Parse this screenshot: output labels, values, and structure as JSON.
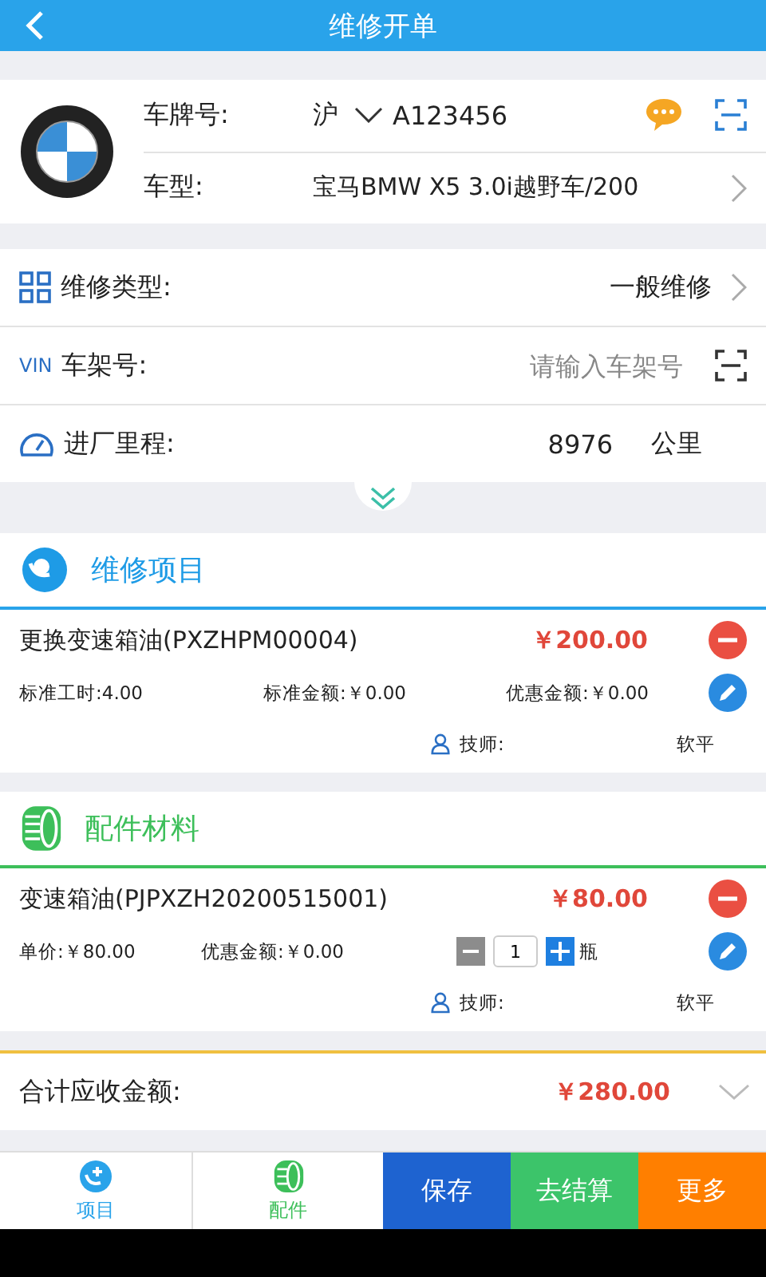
{
  "header": {
    "title": "维修开单"
  },
  "vehicle": {
    "plate_label": "车牌号:",
    "plate_province": "沪",
    "plate_number": "A123456",
    "model_label": "车型:",
    "model": "宝马BMW X5 3.0i越野车/200"
  },
  "info_rows": [
    {
      "kind": "select",
      "label": "维修类型:",
      "value": "一般维修"
    },
    {
      "kind": "vin",
      "prefix": "VIN",
      "label": "车架号:",
      "placeholder": "请输入车架号"
    },
    {
      "kind": "mileage",
      "label": "进厂里程:",
      "value": "8976",
      "unit": "公里"
    }
  ],
  "services": {
    "title": "维修项目",
    "items": [
      {
        "name": "更换变速箱油(PXZHPM00004)",
        "price": "￥200.00",
        "hours": "标准工时:4.00",
        "standard_amount": "标准金额:￥0.00",
        "discount": "优惠金额:￥0.00",
        "tech_label": "技师:",
        "tech": "软平"
      }
    ]
  },
  "parts": {
    "title": "配件材料",
    "items": [
      {
        "name": "变速箱油(PJPXZH20200515001)",
        "price": "￥80.00",
        "unit_price": "单价:￥80.00",
        "discount": "优惠金额:￥0.00",
        "quantity": "1",
        "unit": "瓶",
        "tech_label": "技师:",
        "tech": "软平"
      }
    ]
  },
  "total": {
    "label": "合计应收金额:",
    "amount": "￥280.00"
  },
  "bottom_bar": [
    {
      "kind": "tab",
      "label": "项目",
      "color": "#29a3ea"
    },
    {
      "kind": "tab",
      "label": "配件",
      "color": "#3dbf5a"
    },
    {
      "kind": "button",
      "label": "保存",
      "color": "#1e63d0"
    },
    {
      "kind": "button",
      "label": "去结算",
      "color": "#3cc46a"
    },
    {
      "kind": "button",
      "label": "更多",
      "color": "#ff7f00"
    }
  ]
}
